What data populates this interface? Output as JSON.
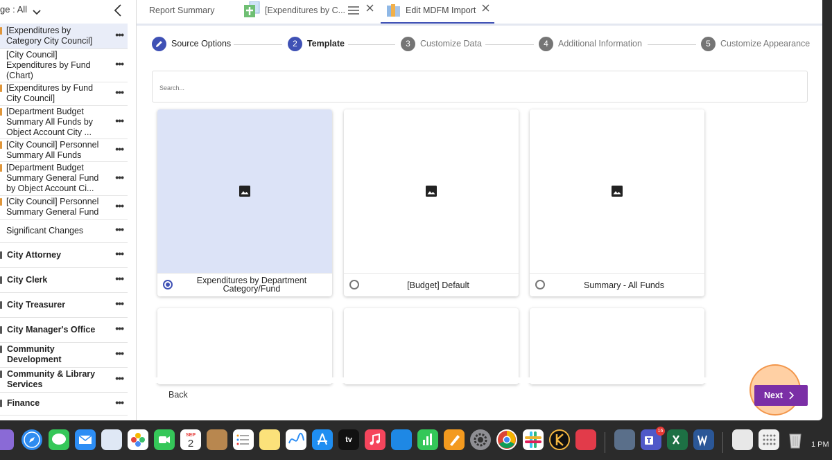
{
  "sidebar": {
    "filter_label": "ge : All",
    "items": [
      {
        "label": "[Expenditures by Category City Council]",
        "lines": [
          "[Expenditures by",
          "Category City Council]"
        ],
        "type": "report",
        "selected": true
      },
      {
        "label": "[City Council] Expenditures by Fund (Chart)",
        "lines": [
          "[City Council]",
          "Expenditures by Fund",
          "(Chart)"
        ],
        "type": "plain"
      },
      {
        "label": "[Expenditures by Fund City Council]",
        "lines": [
          "[Expenditures by Fund",
          "City Council]"
        ],
        "type": "report"
      },
      {
        "label": "[Department Budget Summary All Funds by Object Account City ...",
        "lines": [
          "[Department Budget",
          "Summary All Funds by",
          "Object Account City ..."
        ],
        "type": "report"
      },
      {
        "label": "[City Council] Personnel Summary All Funds",
        "lines": [
          "[City Council] Personnel",
          "Summary All Funds"
        ],
        "type": "report"
      },
      {
        "label": "[Department Budget Summary General Fund by Object Account Ci...",
        "lines": [
          "[Department Budget",
          "Summary General Fund",
          "by Object Account Ci..."
        ],
        "type": "report"
      },
      {
        "label": "[City Council] Personnel Summary General Fund",
        "lines": [
          "[City Council] Personnel",
          "Summary General Fund"
        ],
        "type": "report"
      },
      {
        "label": "Significant Changes",
        "lines": [
          "Significant Changes"
        ],
        "type": "plain"
      },
      {
        "label": "City Attorney",
        "lines": [
          "City Attorney"
        ],
        "type": "category"
      },
      {
        "label": "City Clerk",
        "lines": [
          "City Clerk"
        ],
        "type": "category"
      },
      {
        "label": "City Treasurer",
        "lines": [
          "City Treasurer"
        ],
        "type": "category"
      },
      {
        "label": "City Manager's Office",
        "lines": [
          "City Manager's Office"
        ],
        "type": "category"
      },
      {
        "label": "Community Development",
        "lines": [
          "Community",
          "Development"
        ],
        "type": "category"
      },
      {
        "label": "Community & Library Services",
        "lines": [
          "Community & Library",
          "Services"
        ],
        "type": "category"
      },
      {
        "label": "Finance",
        "lines": [
          "Finance"
        ],
        "type": "category"
      }
    ],
    "more_label": "•••"
  },
  "tabs": [
    {
      "label": "Report Summary"
    },
    {
      "label": "[Expenditures by C..."
    },
    {
      "label": "Edit MDFM Import",
      "active": true
    }
  ],
  "stepper": [
    {
      "num": "",
      "label": "Source Options",
      "state": "done"
    },
    {
      "num": "2",
      "label": "Template",
      "state": "current"
    },
    {
      "num": "3",
      "label": "Customize Data",
      "state": "todo"
    },
    {
      "num": "4",
      "label": "Additional Information",
      "state": "todo"
    },
    {
      "num": "5",
      "label": "Customize Appearance",
      "state": "todo"
    }
  ],
  "search": {
    "placeholder": "Search..."
  },
  "templates": [
    {
      "name": "Expenditures by Department Category/Fund",
      "lines": [
        "Expenditures by Department",
        "Category/Fund"
      ],
      "selected": true
    },
    {
      "name": "[Budget] Default",
      "lines": [
        "[Budget] Default"
      ],
      "selected": false
    },
    {
      "name": "Summary - All Funds",
      "lines": [
        "Summary - All Funds"
      ],
      "selected": false
    }
  ],
  "footer": {
    "back_label": "Back",
    "next_label": "Next"
  },
  "dock": {
    "calendar_month": "SEP",
    "calendar_day": "2",
    "teams_badge": "16",
    "tv_label": "tv",
    "clock": "1 PM"
  },
  "colors": {
    "primary": "#3f51b5",
    "next_button": "#7b2fa6",
    "selected_card": "#dce3f7",
    "report_marker": "#e0963a"
  }
}
